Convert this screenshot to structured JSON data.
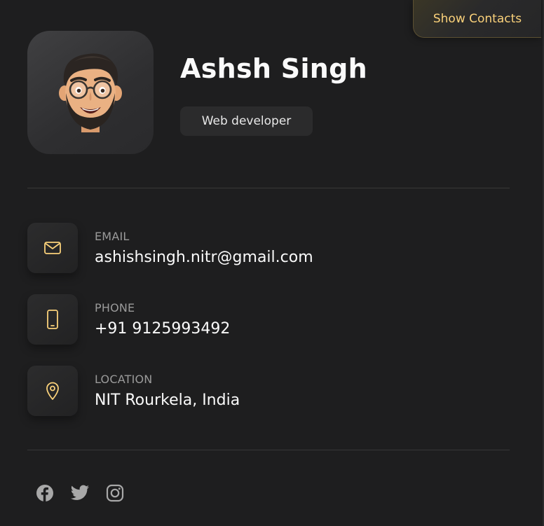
{
  "toggle": {
    "label": "Show Contacts"
  },
  "profile": {
    "name": "Ashsh Singh",
    "title": "Web developer",
    "avatar_icon": "memoji-avatar"
  },
  "contacts": [
    {
      "icon": "mail-icon",
      "title": "Email",
      "value": "ashishsingh.nitr@gmail.com"
    },
    {
      "icon": "phone-icon",
      "title": "Phone",
      "value": "+91 9125993492"
    },
    {
      "icon": "location-icon",
      "title": "Location",
      "value": "NIT Rourkela, India"
    }
  ],
  "socials": [
    {
      "icon": "facebook-icon"
    },
    {
      "icon": "twitter-icon"
    },
    {
      "icon": "instagram-icon"
    }
  ],
  "colors": {
    "background": "#1e1e1f",
    "accent": "#fad17a",
    "text": "#fafafa",
    "muted": "#9a9a9a"
  }
}
